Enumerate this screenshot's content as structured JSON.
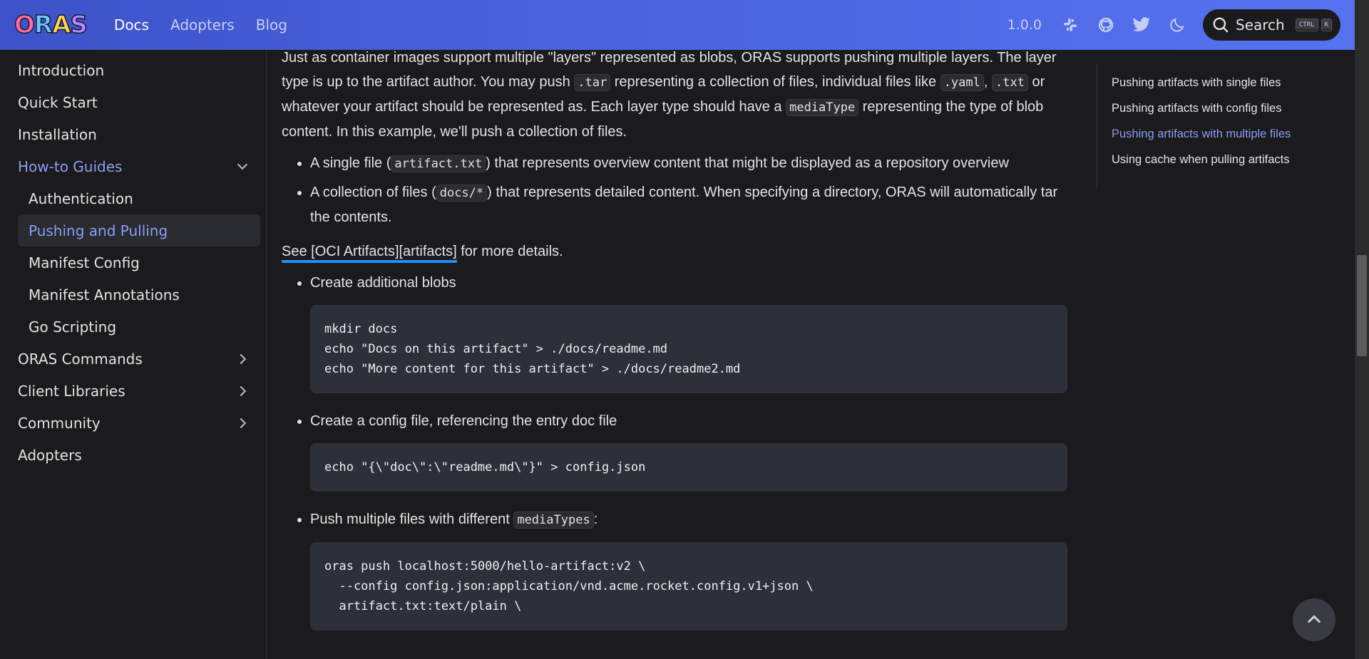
{
  "navbar": {
    "logo_letters": [
      "O",
      "R",
      "A",
      "S"
    ],
    "logo_colors": [
      "#ff6b9d",
      "#6fc7ff",
      "#ffd54a",
      "#b98aff"
    ],
    "links": [
      "Docs",
      "Adopters",
      "Blog"
    ],
    "version": "1.0.0",
    "icons": [
      "slack-icon",
      "github-icon",
      "twitter-icon",
      "moon-icon"
    ],
    "search_label": "Search",
    "search_keys": [
      "CTRL",
      "K"
    ]
  },
  "sidebar": {
    "items": [
      {
        "label": "Introduction"
      },
      {
        "label": "Quick Start"
      },
      {
        "label": "Installation"
      },
      {
        "label": "How-to Guides"
      },
      {
        "label": "Authentication"
      },
      {
        "label": "Pushing and Pulling"
      },
      {
        "label": "Manifest Config"
      },
      {
        "label": "Manifest Annotations"
      },
      {
        "label": "Go Scripting"
      },
      {
        "label": "ORAS Commands"
      },
      {
        "label": "Client Libraries"
      },
      {
        "label": "Community"
      },
      {
        "label": "Adopters"
      }
    ]
  },
  "content": {
    "intro": {
      "p1": "Just as container images support multiple \"layers\" represented as blobs, ORAS supports pushing multiple layers. The layer type is up to the artifact author. You may push ",
      "code1": ".tar",
      "p2": " representing a collection of files, individual files like ",
      "code2": ".yaml",
      "p3": ",",
      "code3": ".txt",
      "p4": " or whatever your artifact should be represented as. Each layer type should have a ",
      "code4": "mediaType",
      "p5": " representing the type of blob content. In this example, we'll push a collection of files."
    },
    "bullets1": {
      "b1_pre": "A single file (",
      "b1_code": "artifact.txt",
      "b1_post": ") that represents overview content that might be displayed as a repository overview",
      "b2_pre": "A collection of files (",
      "b2_code": "docs/*",
      "b2_post": ") that represents detailed content. When specifying a directory, ORAS will automatically tar the contents."
    },
    "see": {
      "link": "See [OCI Artifacts][artifacts]",
      "rest": " for more details."
    },
    "step1": "Create additional blobs",
    "code1": "mkdir docs\necho \"Docs on this artifact\" > ./docs/readme.md\necho \"More content for this artifact\" > ./docs/readme2.md",
    "step2": "Create a config file, referencing the entry doc file",
    "code2": "echo \"{\\\"doc\\\":\\\"readme.md\\\"}\" > config.json",
    "step3_pre": "Push multiple files with different ",
    "step3_code": "mediaTypes",
    "step3_post": ":",
    "code3": "oras push localhost:5000/hello-artifact:v2 \\\n  --config config.json:application/vnd.acme.rocket.config.v1+json \\\n  artifact.txt:text/plain \\"
  },
  "toc": {
    "items": [
      "Pushing artifacts with single files",
      "Pushing artifacts with config files",
      "Pushing artifacts with multiple files",
      "Using cache when pulling artifacts"
    ]
  },
  "colors": {
    "accent": "#8b9cf1",
    "navbar_gradient": [
      "#3d52c9",
      "#5572f0"
    ],
    "link_underline": "#1e90ff"
  }
}
